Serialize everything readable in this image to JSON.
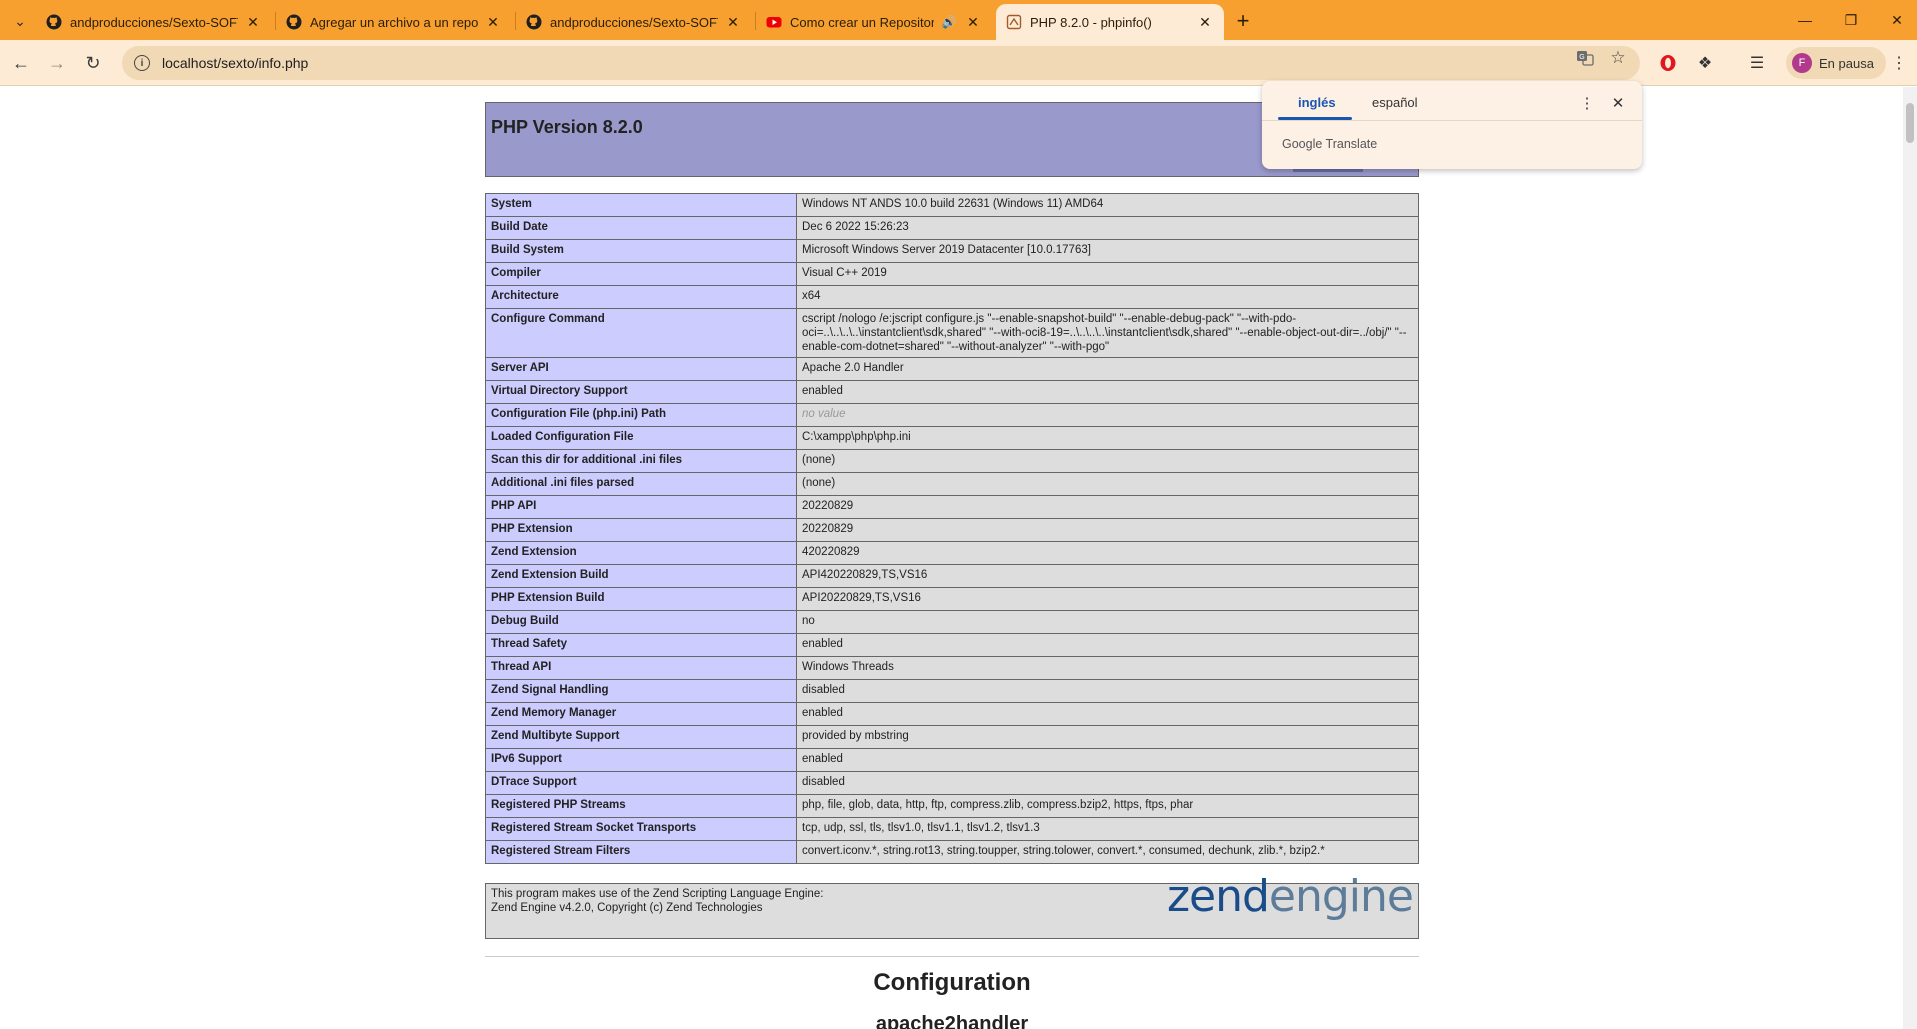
{
  "browser": {
    "tabs": [
      {
        "title": "andproducciones/Sexto-SOFTWARE",
        "icon": "github-icon"
      },
      {
        "title": "Agregar un archivo a un repositorio",
        "icon": "github-icon"
      },
      {
        "title": "andproducciones/Sexto-SOFTWARE",
        "icon": "github-icon"
      },
      {
        "title": "Como crear un Repositorio",
        "icon": "youtube-icon"
      },
      {
        "title": "PHP 8.2.0 - phpinfo()",
        "icon": "php-doc-icon"
      }
    ],
    "url": "localhost/sexto/info.php",
    "profile_label": "En pausa",
    "profile_initial": "F",
    "accent_color": "#f7a02f"
  },
  "translate_popup": {
    "source_lang": "inglés",
    "target_lang": "español",
    "brand": "Google Translate"
  },
  "php": {
    "version_title": "PHP Version 8.2.0",
    "rows": [
      {
        "label": "System",
        "value": "Windows NT ANDS 10.0 build 22631 (Windows 11) AMD64"
      },
      {
        "label": "Build Date",
        "value": "Dec 6 2022 15:26:23"
      },
      {
        "label": "Build System",
        "value": "Microsoft Windows Server 2019 Datacenter [10.0.17763]"
      },
      {
        "label": "Compiler",
        "value": "Visual C++ 2019"
      },
      {
        "label": "Architecture",
        "value": "x64"
      },
      {
        "label": "Configure Command",
        "value": "cscript /nologo /e:jscript configure.js \"--enable-snapshot-build\" \"--enable-debug-pack\" \"--with-pdo-oci=..\\..\\..\\..\\instantclient\\sdk,shared\" \"--with-oci8-19=..\\..\\..\\..\\instantclient\\sdk,shared\" \"--enable-object-out-dir=../obj/\" \"--enable-com-dotnet=shared\" \"--without-analyzer\" \"--with-pgo\""
      },
      {
        "label": "Server API",
        "value": "Apache 2.0 Handler"
      },
      {
        "label": "Virtual Directory Support",
        "value": "enabled"
      },
      {
        "label": "Configuration File (php.ini) Path",
        "value": "no value"
      },
      {
        "label": "Loaded Configuration File",
        "value": "C:\\xampp\\php\\php.ini"
      },
      {
        "label": "Scan this dir for additional .ini files",
        "value": "(none)"
      },
      {
        "label": "Additional .ini files parsed",
        "value": "(none)"
      },
      {
        "label": "PHP API",
        "value": "20220829"
      },
      {
        "label": "PHP Extension",
        "value": "20220829"
      },
      {
        "label": "Zend Extension",
        "value": "420220829"
      },
      {
        "label": "Zend Extension Build",
        "value": "API420220829,TS,VS16"
      },
      {
        "label": "PHP Extension Build",
        "value": "API20220829,TS,VS16"
      },
      {
        "label": "Debug Build",
        "value": "no"
      },
      {
        "label": "Thread Safety",
        "value": "enabled"
      },
      {
        "label": "Thread API",
        "value": "Windows Threads"
      },
      {
        "label": "Zend Signal Handling",
        "value": "disabled"
      },
      {
        "label": "Zend Memory Manager",
        "value": "enabled"
      },
      {
        "label": "Zend Multibyte Support",
        "value": "provided by mbstring"
      },
      {
        "label": "IPv6 Support",
        "value": "enabled"
      },
      {
        "label": "DTrace Support",
        "value": "disabled"
      },
      {
        "label": "Registered PHP Streams",
        "value": "php, file, glob, data, http, ftp, compress.zlib, compress.bzip2, https, ftps, phar"
      },
      {
        "label": "Registered Stream Socket Transports",
        "value": "tcp, udp, ssl, tls, tlsv1.0, tlsv1.1, tlsv1.2, tlsv1.3"
      },
      {
        "label": "Registered Stream Filters",
        "value": "convert.iconv.*, string.rot13, string.toupper, string.tolower, convert.*, consumed, dechunk, zlib.*, bzip2.*"
      }
    ],
    "zend_line1": "This program makes use of the Zend Scripting Language Engine:",
    "zend_line2": "Zend Engine v4.2.0, Copyright (c) Zend Technologies",
    "zend_logo_a": "zend",
    "zend_logo_b": "engine",
    "section_title": "Configuration",
    "subsection_title": "apache2handler"
  }
}
